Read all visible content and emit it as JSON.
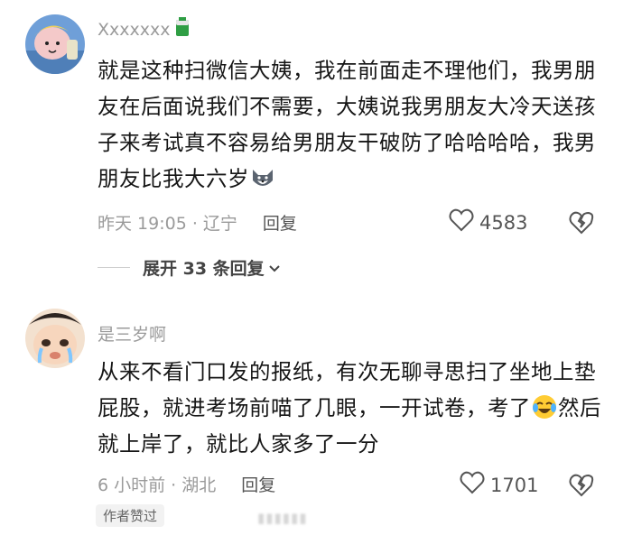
{
  "comments": [
    {
      "username": "Xxxxxxx",
      "text": "就是这种扫微信大姨，我在前面走不理他们，我男朋友在后面说我们不需要，大姨说我男朋友大冷天送孩子来考试真不容易给男朋友干破防了哈哈哈哈，我男朋友比我大六岁",
      "text_emoji": "wolf-emoji",
      "time_location": "昨天 19:05 · 辽宁",
      "reply_label": "回复",
      "likes": "4583",
      "expand_label": "展开 33 条回复"
    },
    {
      "username": "是三岁啊",
      "text_part1": "从来不看门口发的报纸，有次无聊寻思扫了坐地上垫屁股，就进考场前喵了几眼，一开试卷，考了",
      "text_emoji": "crying-laughing-emoji",
      "text_part2": "然后就上岸了，就比人家多了一分",
      "time_location": "6 小时前 · 湖北",
      "reply_label": "回复",
      "likes": "1701",
      "author_badge": "作者赞过"
    }
  ],
  "colors": {
    "muted": "#9a9a9a",
    "text": "#161616",
    "badge_bg": "#f2f2f2"
  }
}
